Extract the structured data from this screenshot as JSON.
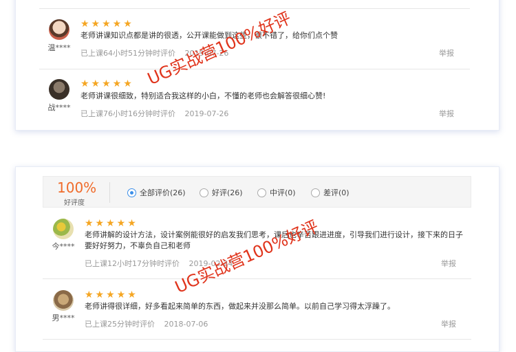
{
  "section_top": {
    "reviews": [
      {
        "user": "温****",
        "stars": "★★★★★",
        "text": "老师讲课知识点都是讲的很透，公开课能做到这些，很不错了，给你们点个赞",
        "studied": "已上课64小时51分钟时评价",
        "date": "2019-07-26",
        "report": "举报"
      },
      {
        "user": "战****",
        "stars": "★★★★★",
        "text": "老师讲课很细致，特别适合我这样的小白，不懂的老师也会解答很细心赞!",
        "studied": "已上课76小时16分钟时评价",
        "date": "2019-07-26",
        "report": "举报"
      }
    ]
  },
  "summary": {
    "percent": "100%",
    "percent_label": "好评度",
    "filters": [
      {
        "label": "全部评价(26)",
        "selected": true
      },
      {
        "label": "好评(26)",
        "selected": false
      },
      {
        "label": "中评(0)",
        "selected": false
      },
      {
        "label": "差评(0)",
        "selected": false
      }
    ]
  },
  "section_bottom": {
    "reviews": [
      {
        "user": "今****",
        "stars": "★★★★★",
        "text": "老师讲解的设计方法，设计案例能很好的启发我们思考，课后也辛苦跟进进度，引导我们进行设计，接下来的日子要好好努力，不辜负自己和老师",
        "studied": "已上课12小时17分钟时评价",
        "date": "2019-02-24",
        "report": "举报"
      },
      {
        "user": "男****",
        "stars": "★★★★★",
        "text": "老师讲得很详细，好多看起来简单的东西，做起来并没那么简单。以前自己学习得太浮躁了。",
        "studied": "已上课25分钟时评价",
        "date": "2018-07-06",
        "report": "举报"
      }
    ]
  },
  "watermarks": [
    "UG实战营100%好评",
    "UG实战营100%好评",
    "UG实战营100%好评"
  ],
  "colors": {
    "star": "#f5a623",
    "percent": "#f06b2a",
    "radio_selected": "#3b8ee8",
    "watermark": "#e0341c"
  }
}
